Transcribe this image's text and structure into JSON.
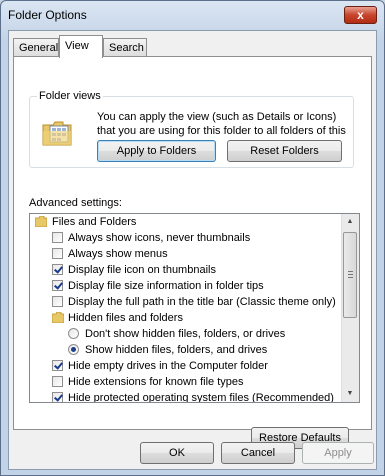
{
  "window": {
    "title": "Folder Options",
    "close_glyph": "x"
  },
  "tabs": [
    {
      "label": "General",
      "active": false
    },
    {
      "label": "View",
      "active": true
    },
    {
      "label": "Search",
      "active": false
    }
  ],
  "folder_views": {
    "group_label": "Folder views",
    "description": "You can apply the view (such as Details or Icons) that you are using for this folder to all folders of this type.",
    "icon": "folder-views-icon",
    "apply_button": "Apply to Folders",
    "reset_button": "Reset Folders"
  },
  "advanced": {
    "label": "Advanced settings:",
    "items": [
      {
        "type": "folder",
        "label": "Files and Folders",
        "indent": 0
      },
      {
        "type": "checkbox",
        "label": "Always show icons, never thumbnails",
        "checked": false,
        "indent": 1
      },
      {
        "type": "checkbox",
        "label": "Always show menus",
        "checked": false,
        "indent": 1
      },
      {
        "type": "checkbox",
        "label": "Display file icon on thumbnails",
        "checked": true,
        "indent": 1
      },
      {
        "type": "checkbox",
        "label": "Display file size information in folder tips",
        "checked": true,
        "indent": 1
      },
      {
        "type": "checkbox",
        "label": "Display the full path in the title bar (Classic theme only)",
        "checked": false,
        "indent": 1
      },
      {
        "type": "folder",
        "label": "Hidden files and folders",
        "indent": 1
      },
      {
        "type": "radio",
        "label": "Don't show hidden files, folders, or drives",
        "checked": false,
        "indent": 2
      },
      {
        "type": "radio",
        "label": "Show hidden files, folders, and drives",
        "checked": true,
        "indent": 2
      },
      {
        "type": "checkbox",
        "label": "Hide empty drives in the Computer folder",
        "checked": true,
        "indent": 1
      },
      {
        "type": "checkbox",
        "label": "Hide extensions for known file types",
        "checked": false,
        "indent": 1
      },
      {
        "type": "checkbox",
        "label": "Hide protected operating system files (Recommended)",
        "checked": true,
        "indent": 1
      }
    ],
    "restore_button": "Restore Defaults"
  },
  "footer": {
    "ok": "OK",
    "cancel": "Cancel",
    "apply": "Apply"
  },
  "colors": {
    "accent": "#3c7fb1",
    "close": "#c7442d"
  }
}
